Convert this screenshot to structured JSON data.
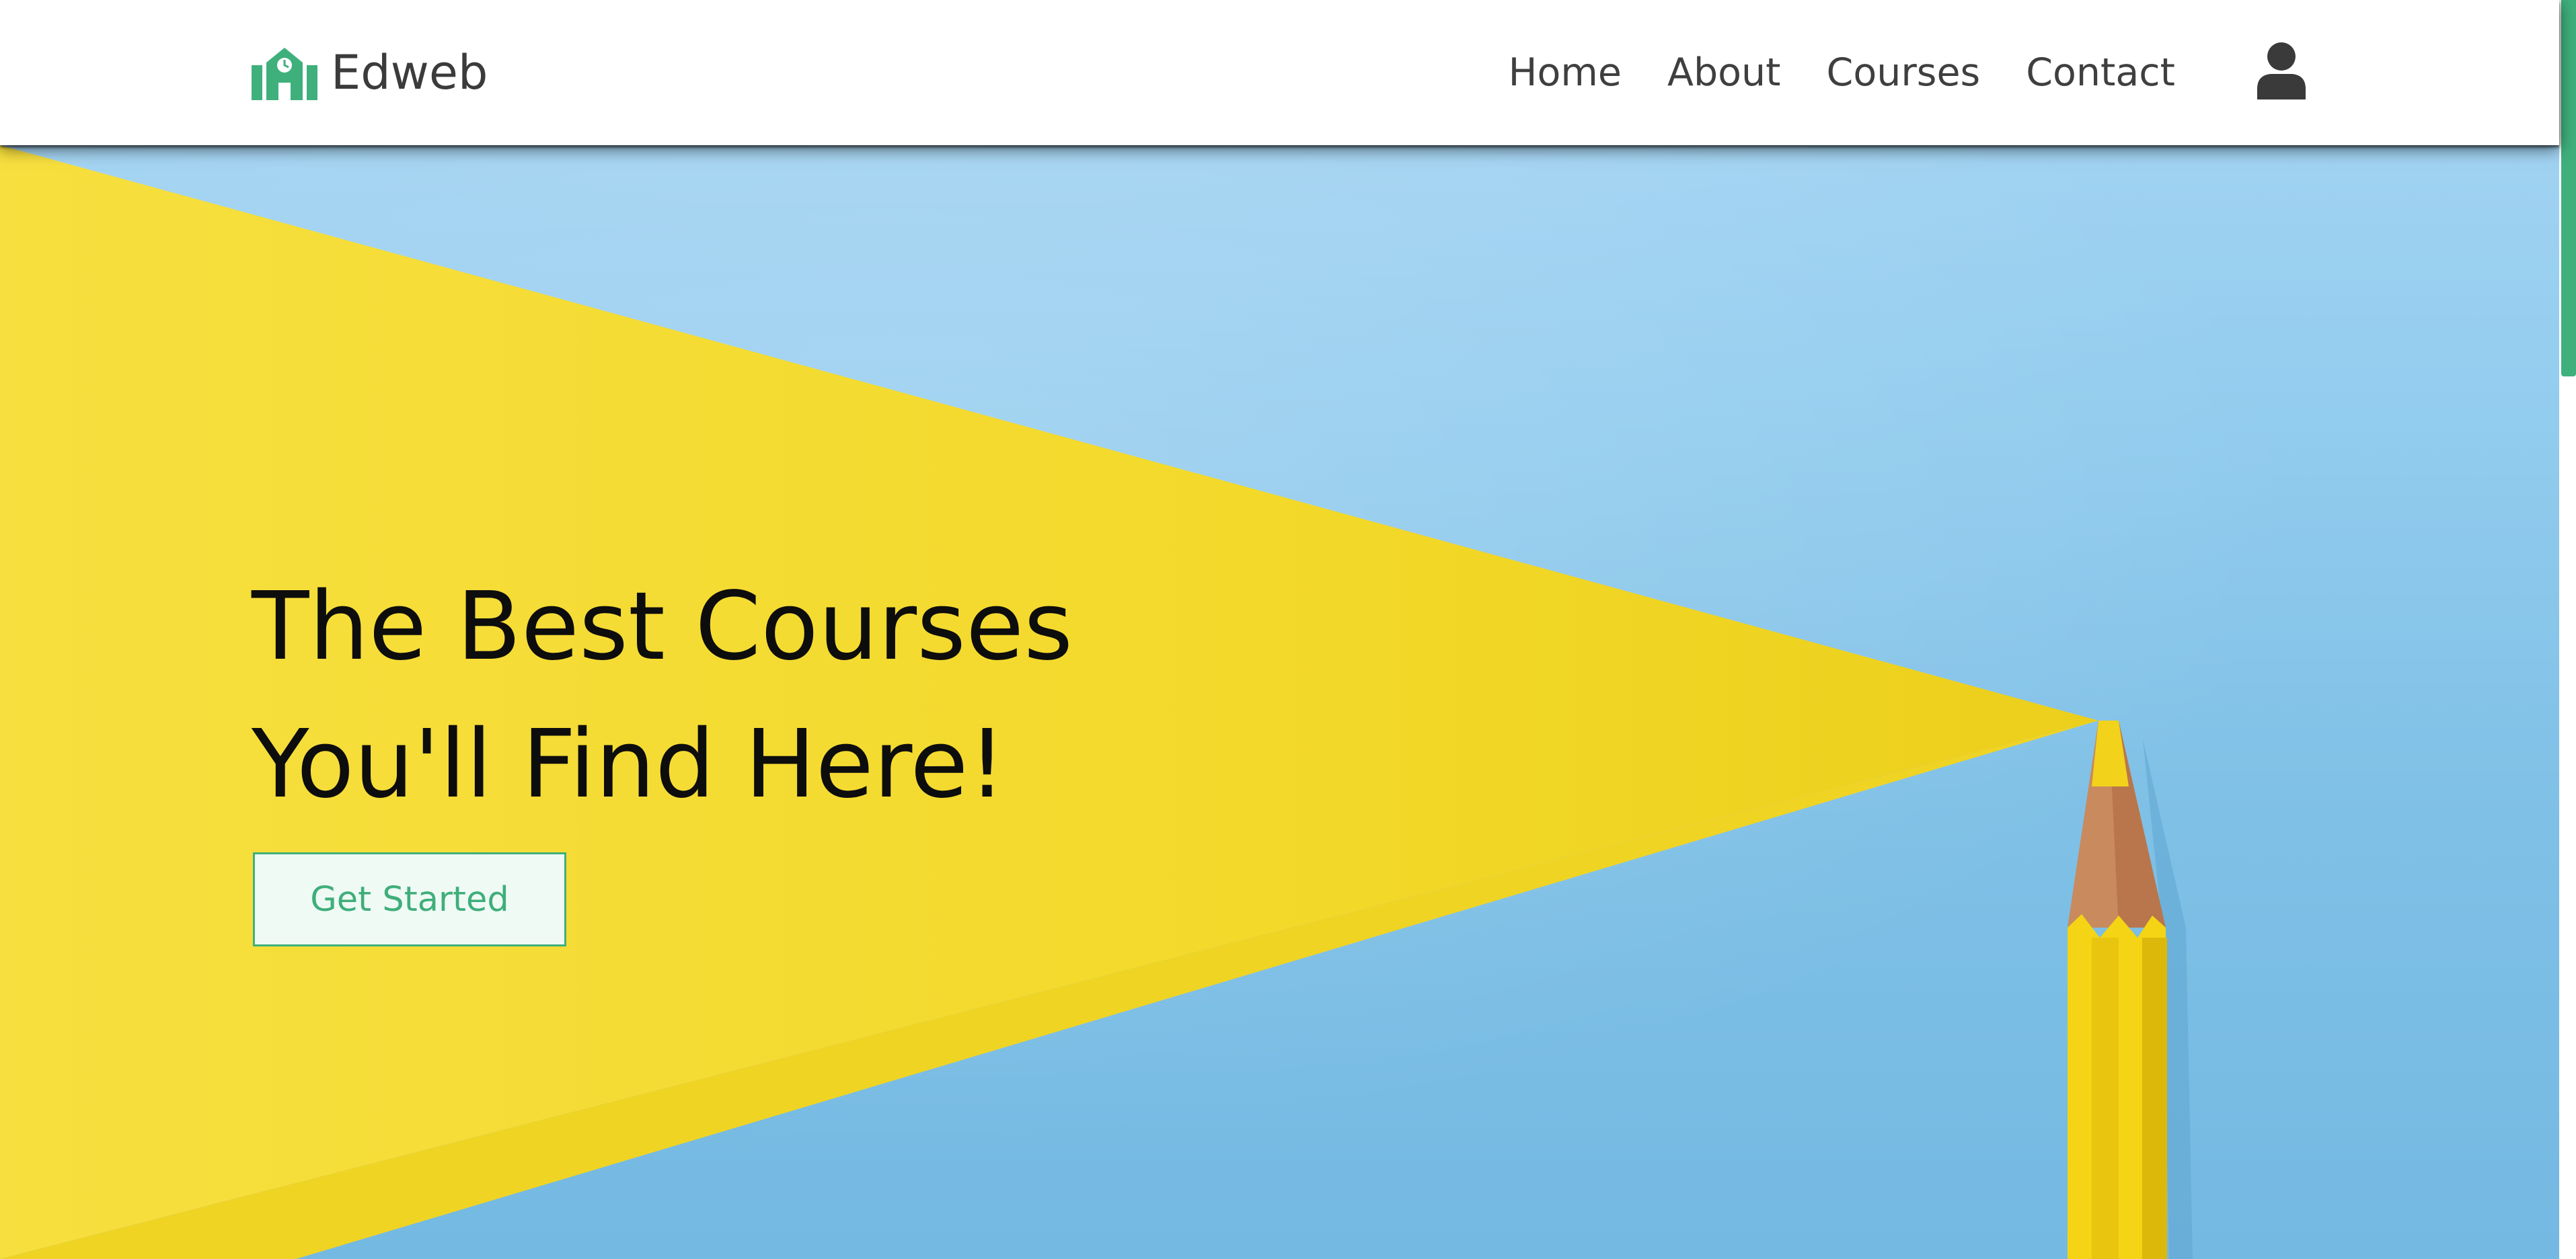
{
  "brand": {
    "name": "Edweb",
    "icon": "school-building-icon",
    "color": "#3fb07c"
  },
  "nav": {
    "links": [
      "Home",
      "About",
      "Courses",
      "Contact"
    ],
    "user_icon": "user-icon"
  },
  "hero": {
    "title_line1": "The Best Courses",
    "title_line2": "You'll Find Here!",
    "cta_label": "Get Started",
    "background_description_colors": {
      "sky_blue": "#8fc9ec",
      "yellow": "#f5d825",
      "pencil_wood": "#c9855a"
    }
  },
  "colors": {
    "accent": "#3fb07c",
    "text_dark": "#0d0d0d",
    "nav_text": "#3f3f3f"
  }
}
